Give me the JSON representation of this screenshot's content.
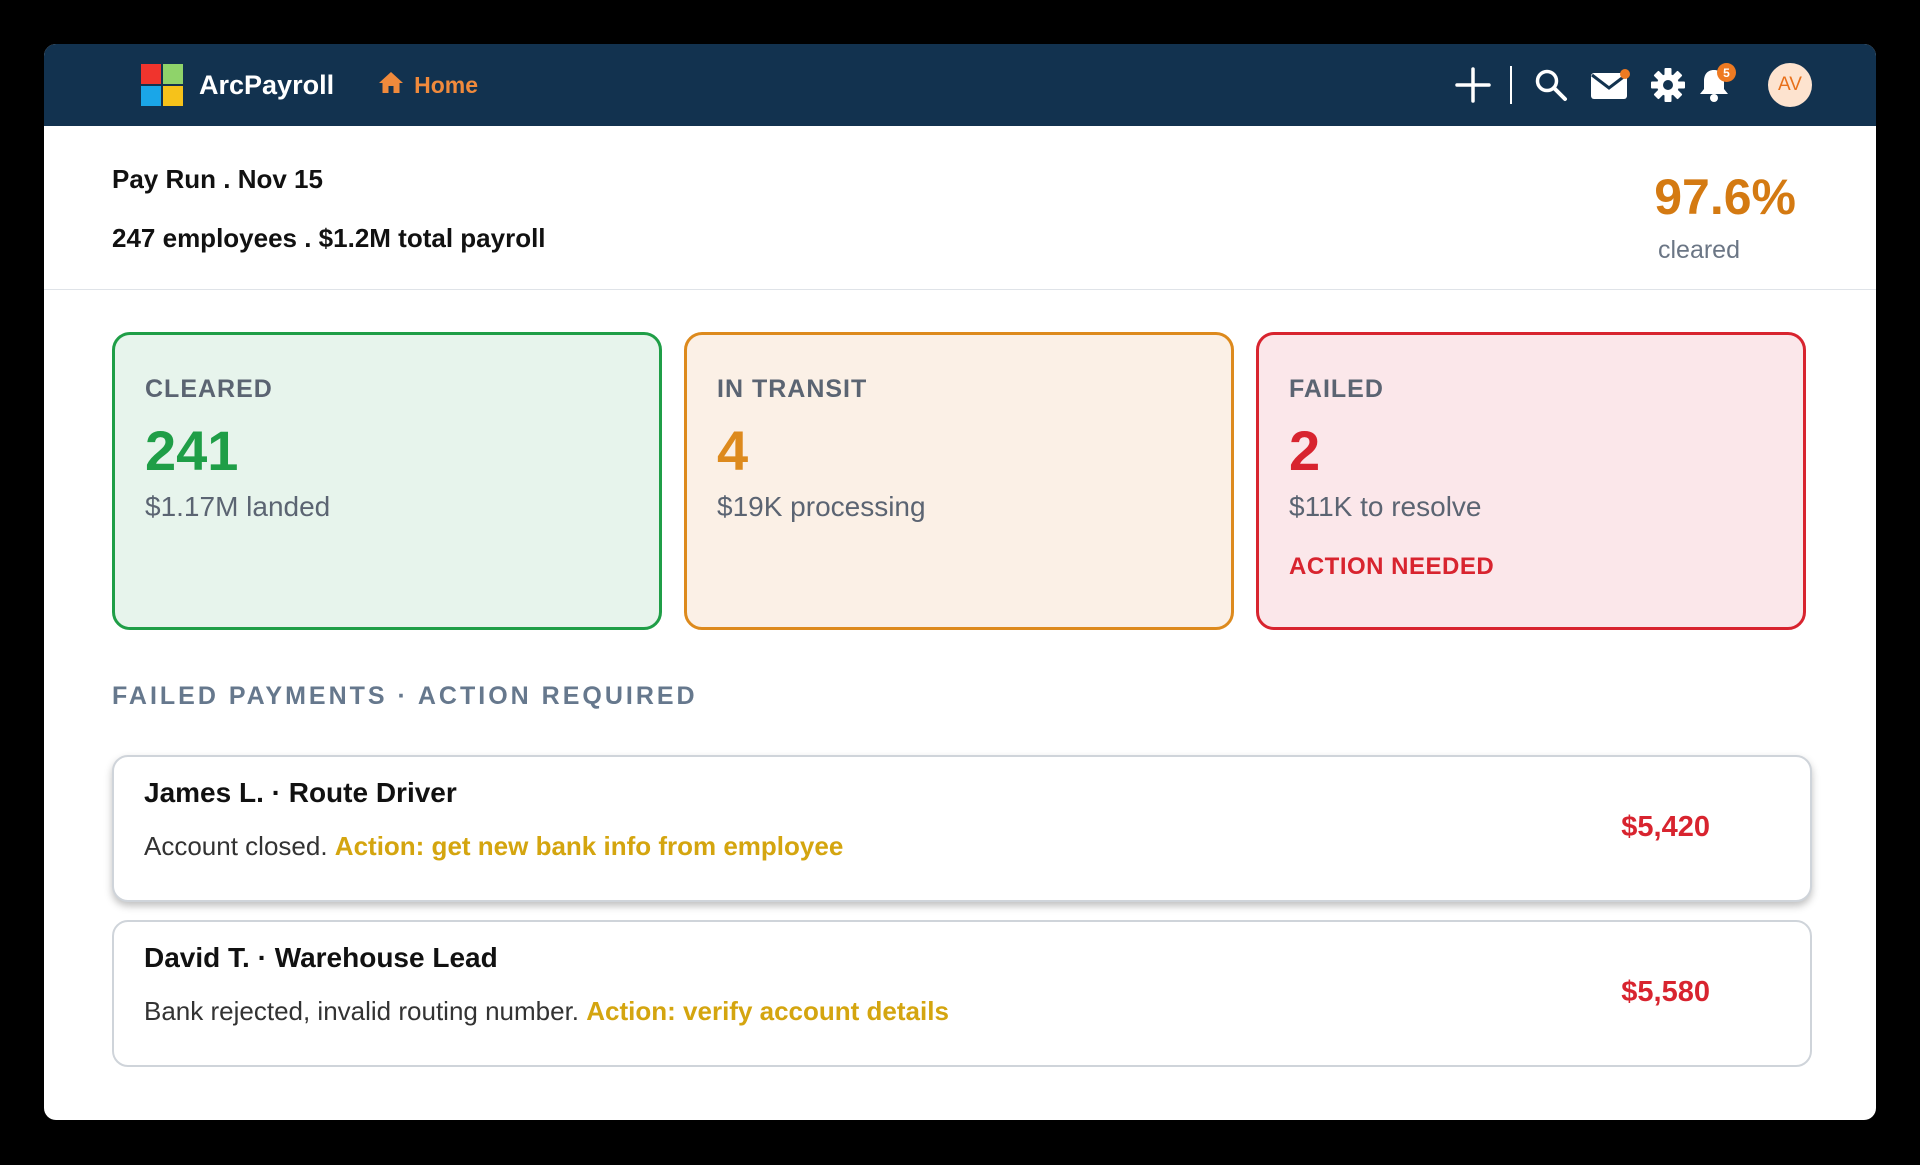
{
  "app": {
    "name": "ArcPayroll",
    "nav_home": "Home",
    "notification_count": "5",
    "avatar_initials": "AV",
    "icons": [
      "plus-icon",
      "search-icon",
      "mail-icon",
      "gear-icon",
      "bell-icon",
      "home-icon"
    ]
  },
  "header": {
    "title": "Pay Run . Nov 15",
    "subtitle": "247 employees . $1.2M total payroll",
    "percent": "97.6%",
    "percent_label": "cleared"
  },
  "cards": [
    {
      "label": "CLEARED",
      "value": "241",
      "sub": "$1.17M landed",
      "color": "#1f9e47"
    },
    {
      "label": "IN TRANSIT",
      "value": "4",
      "sub": "$19K processing",
      "color": "#dd8a1d"
    },
    {
      "label": "FAILED",
      "value": "2",
      "sub": "$11K to resolve",
      "action": "ACTION NEEDED",
      "color": "#d8242f"
    }
  ],
  "failed_section": {
    "title": "FAILED PAYMENTS · ACTION REQUIRED",
    "rows": [
      {
        "name": "James L. · Route Driver",
        "reason": "Account closed.",
        "action": "Action: get new bank info from employee",
        "amount": "$5,420"
      },
      {
        "name": "David T. · Warehouse Lead",
        "reason": "Bank rejected, invalid routing number.",
        "action": "Action: verify account details",
        "amount": "$5,580"
      }
    ]
  }
}
